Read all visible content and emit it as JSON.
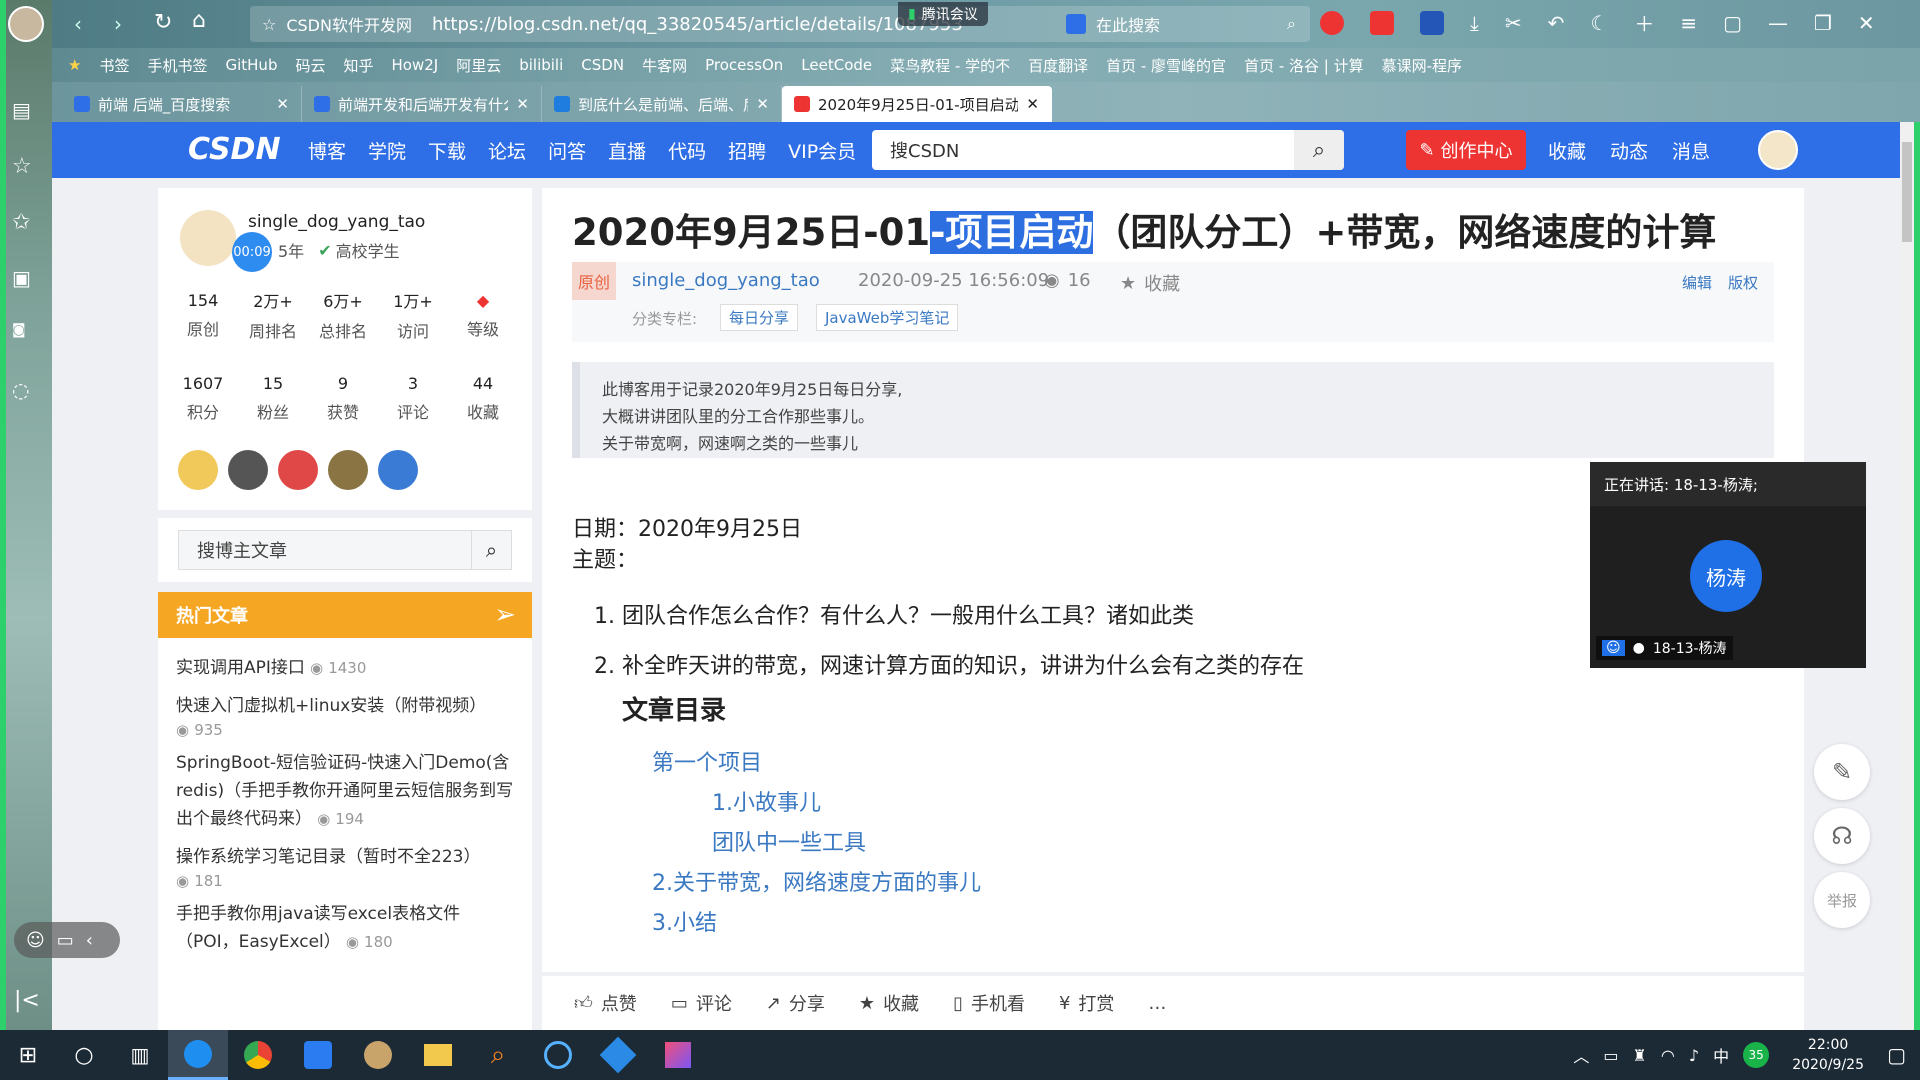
{
  "browser": {
    "title": "CSDN软件开发网",
    "url": "https://blog.csdn.net/qq_33820545/article/details/1087953",
    "meeting_badge": "腾讯会议",
    "search_placeholder": "在此搜索",
    "bookmarks": [
      "书签",
      "手机书签",
      "GitHub",
      "码云",
      "知乎",
      "How2J",
      "阿里云",
      "bilibili",
      "CSDN",
      "牛客网",
      "ProcessOn",
      "LeetCode",
      "菜鸟教程 - 学的不",
      "百度翻译",
      "首页 - 廖雪峰的官",
      "首页 - 洛谷 | 计算",
      "慕课网-程序"
    ],
    "tabs": [
      "前端 后端_百度搜索",
      "前端开发和后端开发有什么区别",
      "到底什么是前端、后端、后台啊",
      "2020年9月25日-01-项目启动"
    ],
    "active_tab_index": 3
  },
  "header": {
    "logo": "CSDN",
    "nav": [
      "博客",
      "学院",
      "下载",
      "论坛",
      "问答",
      "直播",
      "代码",
      "招聘",
      "VIP会员"
    ],
    "search_placeholder": "搜CSDN",
    "create_btn": "创作中心",
    "right_links": [
      "收藏",
      "动态",
      "消息"
    ]
  },
  "profile": {
    "name": "single_dog_yang_tao",
    "years": "5年",
    "verify": "高校学生",
    "timer": "00:09",
    "stats1": [
      {
        "n": "154",
        "l": "原创"
      },
      {
        "n": "2万+",
        "l": "周排名"
      },
      {
        "n": "6万+",
        "l": "总排名"
      },
      {
        "n": "1万+",
        "l": "访问"
      },
      {
        "n": "",
        "l": "等级"
      }
    ],
    "stats2": [
      {
        "n": "1607",
        "l": "积分"
      },
      {
        "n": "15",
        "l": "粉丝"
      },
      {
        "n": "9",
        "l": "获赞"
      },
      {
        "n": "3",
        "l": "评论"
      },
      {
        "n": "44",
        "l": "收藏"
      }
    ],
    "badge_colors": [
      "#f0c95a",
      "#555555",
      "#e04848",
      "#8a7444",
      "#3a7bd5"
    ]
  },
  "blogsearch": {
    "placeholder": "搜博主文章"
  },
  "hot": {
    "title": "热门文章",
    "items": [
      {
        "t": "实现调用API接口",
        "v": "1430"
      },
      {
        "t": "快速入门虚拟机+linux安装（附带视频）",
        "v": "935"
      },
      {
        "t": "SpringBoot-短信验证码-快速入门Demo(含redis)（手把手教你开通阿里云短信服务到写出个最终代码来）",
        "v": "194"
      },
      {
        "t": "操作系统学习笔记目录（暂时不全223）",
        "v": "181"
      },
      {
        "t": "手把手教你用java读写excel表格文件（POI，EasyExcel）",
        "v": "180"
      }
    ]
  },
  "article": {
    "title_pre": "2020年9月25日-01",
    "title_sel": "-项目启动",
    "title_post": "（团队分工）+带宽，网络速度的计算",
    "tag": "原创",
    "author": "single_dog_yang_tao",
    "time": "2020-09-25 16:56:09",
    "views": "16",
    "fav": "收藏",
    "edit": "编辑",
    "copyright": "版权",
    "category_label": "分类专栏:",
    "categories": [
      "每日分享",
      "JavaWeb学习笔记"
    ],
    "quote": [
      "此博客用于记录2020年9月25日每日分享,",
      "大概讲讲团队里的分工合作那些事儿。",
      "关于带宽啊，网速啊之类的一些事儿"
    ],
    "date_line": "日期：2020年9月25日",
    "topic_line": "主题：",
    "list": [
      "团队合作怎么合作？有什么人？一般用什么工具？诸如此类",
      "补全昨天讲的带宽，网速计算方面的知识，讲讲为什么会有之类的存在"
    ],
    "toc_title": "文章目录",
    "toc": [
      {
        "t": "第一个项目",
        "lvl": 1
      },
      {
        "t": "1.小故事儿",
        "lvl": 2
      },
      {
        "t": "团队中一些工具",
        "lvl": 2
      },
      {
        "t": "2.关于带宽，网络速度方面的事儿",
        "lvl": 1
      },
      {
        "t": "3.小结",
        "lvl": 1
      }
    ]
  },
  "toolbar": [
    "点赞",
    "评论",
    "分享",
    "收藏",
    "手机看",
    "打赏",
    "…"
  ],
  "meeting": {
    "speaking": "正在讲话: 18-13-杨涛;",
    "avatar": "杨涛",
    "member": "18-13-杨涛"
  },
  "floatbtns": [
    "举报"
  ],
  "taskbar": {
    "time": "22:00",
    "date": "2020/9/25",
    "ime": "中",
    "badge": "35"
  }
}
